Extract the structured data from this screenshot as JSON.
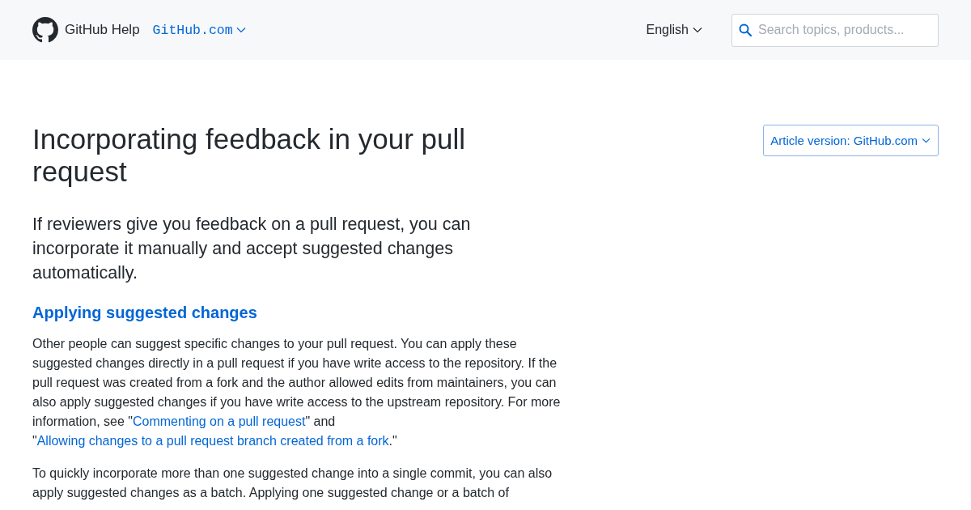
{
  "header": {
    "logo": "GitHub Help",
    "product_picker": "GitHub.com",
    "language_picker": "English",
    "search": {
      "placeholder": "Search topics, products..."
    }
  },
  "article": {
    "title": "Incorporating feedback in your pull request",
    "version_picker": "Article version: GitHub.com",
    "intro": "If reviewers give you feedback on a pull request, you can incorporate it manually and accept suggested changes automatically.",
    "sections": [
      {
        "heading": "Applying suggested changes",
        "paragraphs": [
          [
            {
              "kind": "text",
              "text": "Other people can suggest specific changes to your pull request. You can apply these suggested changes directly in a pull request if you have write access to the repository. If the pull request was created from a fork and the author allowed edits from maintainers, you can also apply suggested changes if you have write access to the upstream repository. For more information, see \""
            },
            {
              "kind": "link",
              "text": "Commenting on a pull request"
            },
            {
              "kind": "text",
              "text": "\" and \""
            },
            {
              "kind": "link",
              "text": "Allowing changes to a pull request branch created from a fork"
            },
            {
              "kind": "text",
              "text": ".\""
            }
          ],
          [
            {
              "kind": "text",
              "text": "To quickly incorporate more than one suggested change into a single commit, you can also apply suggested changes as a batch. Applying one suggested change or a batch of"
            }
          ]
        ]
      }
    ]
  }
}
